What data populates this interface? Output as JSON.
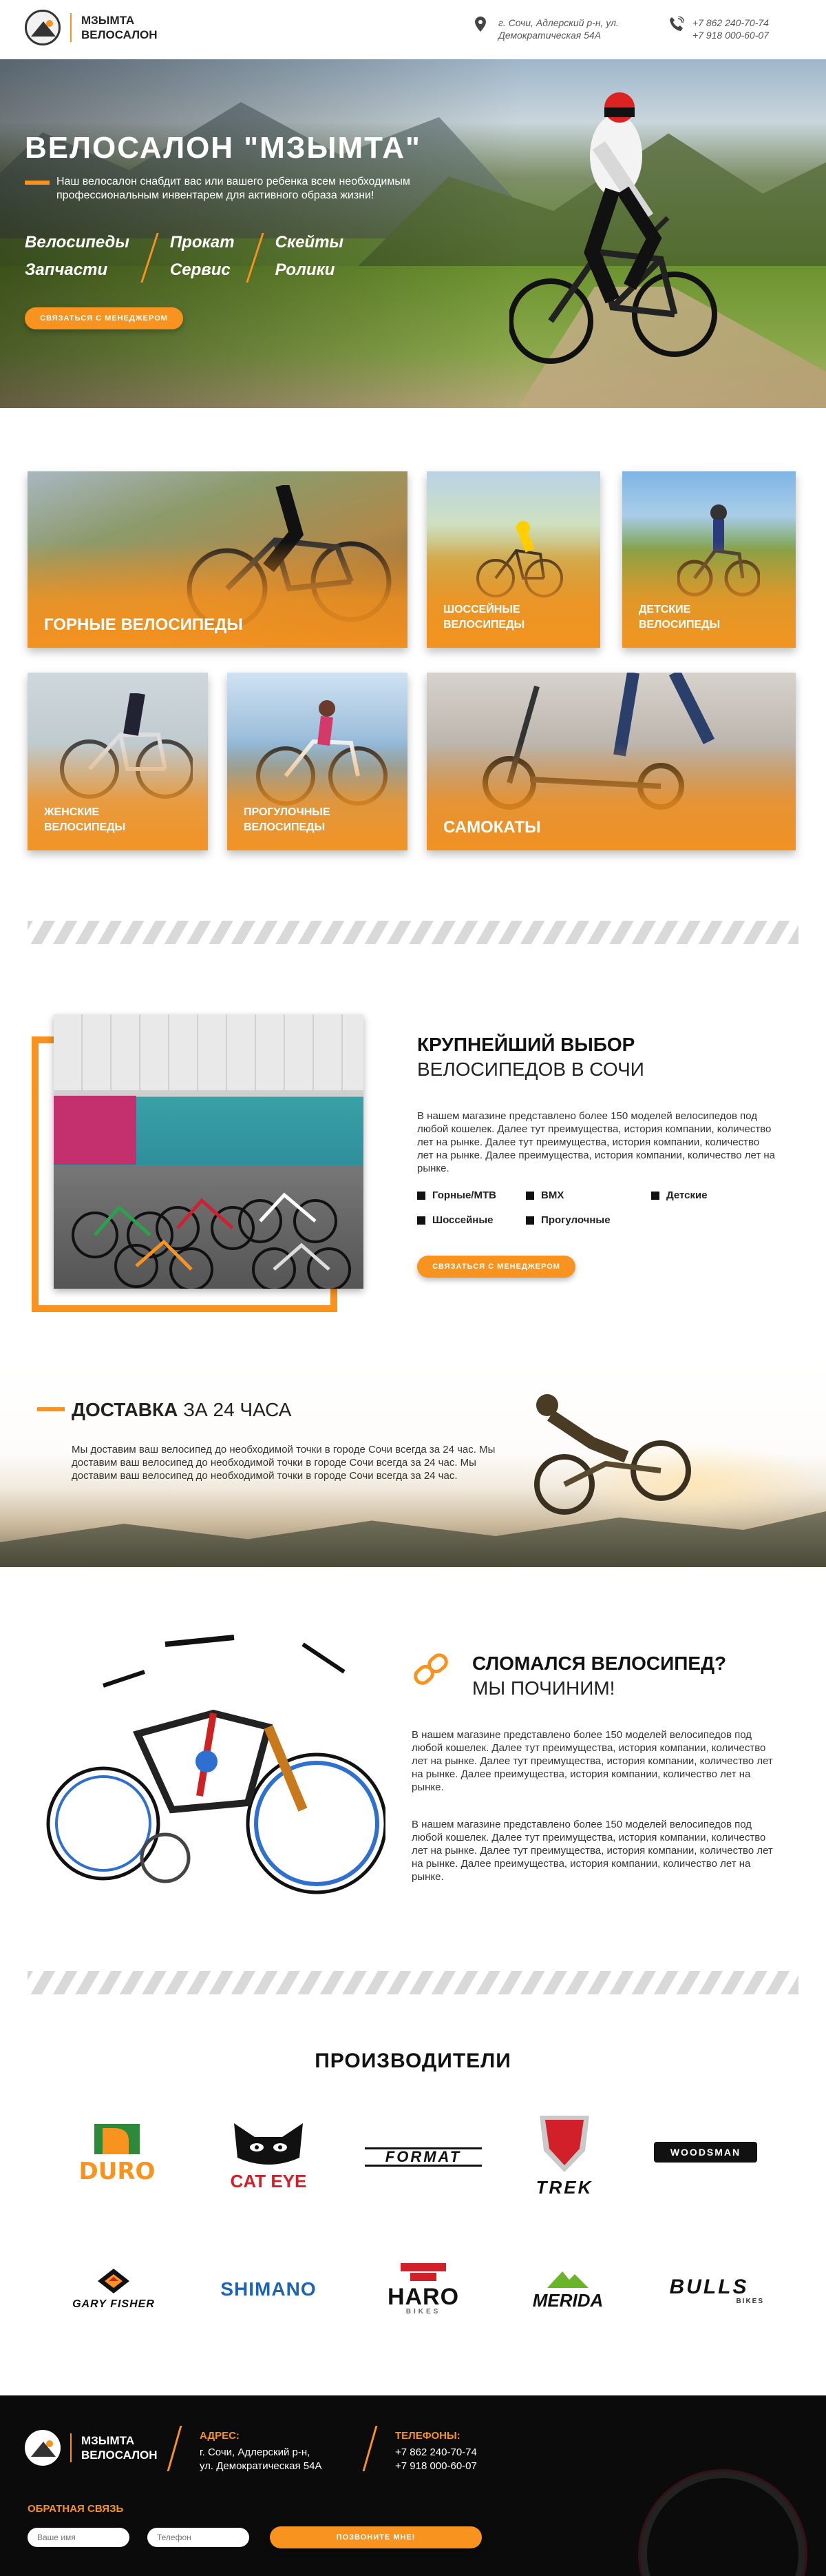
{
  "header": {
    "logo_line1": "МЗЫМТА",
    "logo_line2": "ВЕЛОСАЛОН",
    "address_line1": "г. Сочи, Адлерский р-н, ул.",
    "address_line2": "Демократическая 54А",
    "phone1": "+7 862 240-70-74",
    "phone2": "+7 918 000-60-07",
    "icons": [
      "map-pin-icon",
      "phone-icon"
    ]
  },
  "hero": {
    "title": "ВЕЛОСАЛОН  \"МЗЫМТА\"",
    "subtitle": "Наш велосалон снабдит вас или вашего ребенка всем необходимым профессиональным инвентарем для активного образа жизни!",
    "links": [
      [
        "Велосипеды",
        "Запчасти"
      ],
      [
        "Прокат",
        "Сервис"
      ],
      [
        "Скейты",
        "Ролики"
      ]
    ],
    "button": "СВЯЗАТЬСЯ С МЕНЕДЖЕРОМ"
  },
  "categories": [
    {
      "label": "ГОРНЫЕ ВЕЛОСИПЕДЫ"
    },
    {
      "label": "ШОССЕЙНЫЕ ВЕЛОСИПЕДЫ"
    },
    {
      "label": "ДЕТСКИЕ ВЕЛОСИПЕДЫ"
    },
    {
      "label": "ЖЕНСКИЕ ВЕЛОСИПЕДЫ"
    },
    {
      "label": "ПРОГУЛОЧНЫЕ ВЕЛОСИПЕДЫ"
    },
    {
      "label": "САМОКАТЫ"
    }
  ],
  "selection": {
    "title": "КРУПНЕЙШИЙ ВЫБОР",
    "subtitle": "ВЕЛОСИПЕДОВ В СОЧИ",
    "text": "В нашем магазине представлено более 150 моделей велосипедов под любой кошелек. Далее тут преимущества, история компании, количество лет на рынке. Далее тут преимущества, история компании, количество лет на рынке. Далее преимущества, история компании, количество лет на рынке.",
    "bullets": [
      "Горные/МТВ",
      "BMX",
      "Детские",
      "Шоссейные",
      "Прогулочные"
    ],
    "button": "СВЯЗАТЬСЯ С МЕНЕДЖЕРОМ"
  },
  "delivery": {
    "title_bold": "ДОСТАВКА",
    "title_rest": " ЗА 24 ЧАСА",
    "text": "Мы доставим ваш велосипед до необходимой точки в городе Сочи всегда за 24 час. Мы доставим ваш велосипед до необходимой точки в городе Сочи всегда за 24 час. Мы доставим ваш велосипед до необходимой точки в городе Сочи всегда за 24 час."
  },
  "repair": {
    "title": "СЛОМАЛСЯ ВЕЛОСИПЕД?",
    "subtitle": "МЫ ПОЧИНИМ!",
    "text1": "В нашем магазине представлено более 150 моделей велосипедов под любой кошелек. Далее тут преимущества, история компании, количество лет на рынке. Далее тут преимущества, история компании, количество лет на рынке. Далее преимущества, история компании, количество лет на рынке.",
    "text2": "В нашем магазине представлено более 150 моделей велосипедов под любой кошелек. Далее тут преимущества, история компании, количество лет на рынке. Далее тут преимущества, история компании, количество лет на рынке. Далее преимущества, история компании, количество лет на рынке."
  },
  "brands": {
    "title": "ПРОИЗВОДИТЕЛИ",
    "items": [
      "DURO",
      "CAT EYE",
      "FORMAT",
      "TREK",
      "WOODSMAN",
      "GARY FISHER",
      "SHIMANO",
      "HARO",
      "MERIDA",
      "BULLS"
    ],
    "haro_sub": "BIKES",
    "bulls_sub": "BIKES"
  },
  "footer": {
    "logo_line1": "МЗЫМТА",
    "logo_line2": "ВЕЛОСАЛОН",
    "address_label": "АДРЕС:",
    "address_line1": "г. Сочи, Адлерский р-н,",
    "address_line2": "ул. Демократическая 54А",
    "phones_label": "ТЕЛЕФОНЫ:",
    "phone1": "+7 862 240-70-74",
    "phone2": "+7 918 000-60-07",
    "feedback_label": "ОБРАТНАЯ СВЯЗЬ",
    "name_placeholder": "Ваше имя",
    "phone_placeholder": "Телефон",
    "submit": "ПОЗВОНИТЕ МНЕ!"
  },
  "colors": {
    "accent": "#f7931e",
    "dark": "#0b0b0b"
  }
}
